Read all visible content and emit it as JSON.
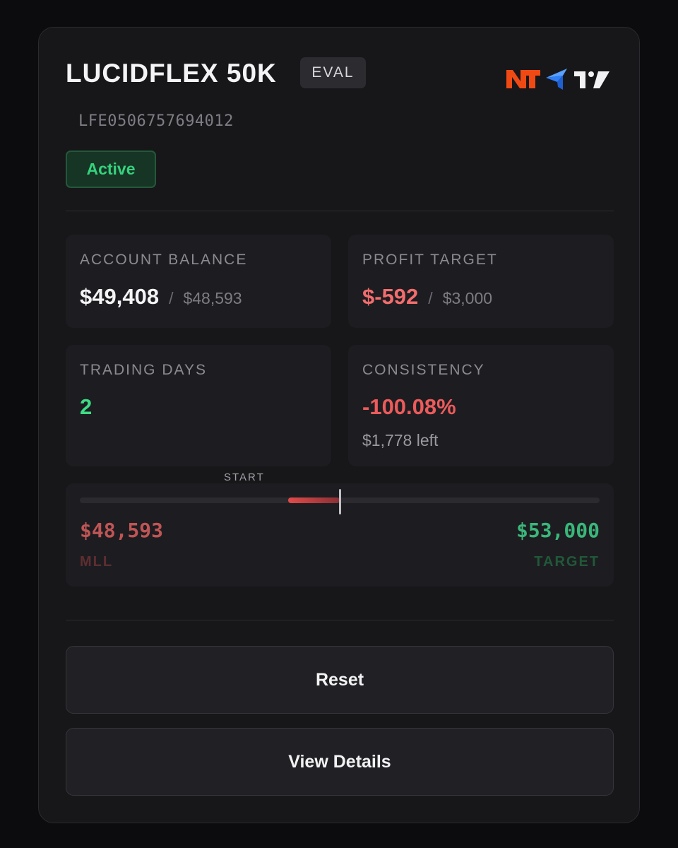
{
  "account": {
    "title": "LUCIDFLEX 50K",
    "type_badge": "EVAL",
    "id": "LFE0506757694012",
    "status": "Active",
    "platform_logos": [
      "ninjatrader-logo",
      "tradovate-logo",
      "tradingview-logo"
    ]
  },
  "stats": {
    "balance": {
      "label": "ACCOUNT BALANCE",
      "value": "$49,408",
      "separator": "/",
      "secondary": "$48,593"
    },
    "profit_target": {
      "label": "PROFIT TARGET",
      "value": "$-592",
      "separator": "/",
      "secondary": "$3,000"
    },
    "trading_days": {
      "label": "TRADING DAYS",
      "value": "2"
    },
    "consistency": {
      "label": "CONSISTENCY",
      "value": "-100.08%",
      "note": "$1,778 left"
    }
  },
  "progress": {
    "start_label": "START",
    "mll_value": "$48,593",
    "mll_label": "MLL",
    "target_value": "$53,000",
    "target_label": "TARGET",
    "current": 49408,
    "start": 50000,
    "min": 47000,
    "max": 53000
  },
  "buttons": {
    "reset": "Reset",
    "view_details": "View Details"
  },
  "colors": {
    "background": "#0c0c0f",
    "card": "#17171a",
    "status_green": "#36d17e",
    "loss_red": "#f26d6d",
    "target_green": "#3ab77a",
    "ninjatrader_orange": "#f04a14",
    "tradovate_blue": "#2f7ef5"
  }
}
